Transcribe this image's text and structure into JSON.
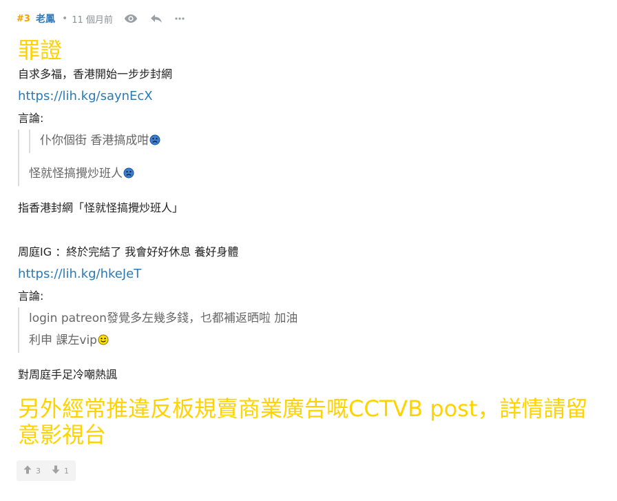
{
  "meta": {
    "post_number": "#3",
    "author": "老鳳",
    "separator": "•",
    "time": "11 個月前",
    "icons": [
      "eye-icon",
      "reply-icon",
      "more-icon"
    ]
  },
  "content": {
    "title": "罪證",
    "intro": "自求多福，香港開始一步步封網",
    "link1": "https://lih.kg/saynEcX",
    "comment_label1": "言論:",
    "quote1_nested": "仆你個街 香港搞成咁",
    "quote1": "怪就怪搞攪炒班人",
    "note1": "指香港封網「怪就怪搞攪炒班人」",
    "para2": "周庭IG ：終於完結了 我會好好休息 養好身體",
    "link2": "https://lih.kg/hkeJeT",
    "comment_label2": "言論:",
    "quote2_line1": "login patreon發覺多左幾多錢，乜都補返晒啦 加油",
    "quote2_line2": "利申 課左vip",
    "note2": "對周庭手足冷嘲熱諷",
    "footer_big": "另外經常推違反板規賣商業廣告嘅CCTVB post，詳情請留意影視台"
  },
  "votes": {
    "up": "3",
    "down": "1"
  },
  "colors": {
    "accent_yellow": "#ffd200",
    "post_number": "#f0a300",
    "author": "#337ab7",
    "link": "#2a7ab5"
  }
}
